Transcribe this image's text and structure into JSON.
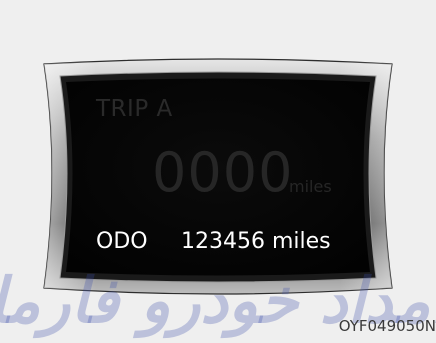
{
  "display": {
    "trip": {
      "label": "TRIP A",
      "value": "0000",
      "unit": "miles"
    },
    "odometer": {
      "label": "ODO",
      "value": "123456 miles"
    }
  },
  "watermark": {
    "text": "امداد خودرو فارما"
  },
  "figure_code": "OYF049050N",
  "colors": {
    "page_background": "#efefef",
    "screen_background": "#050505",
    "active_text": "#ffffff",
    "dimmed_text": "#262626",
    "bezel_highlight": "#d8d8d8",
    "bezel_shadow": "#3a3a3a",
    "watermark": "#3b4aa8"
  }
}
